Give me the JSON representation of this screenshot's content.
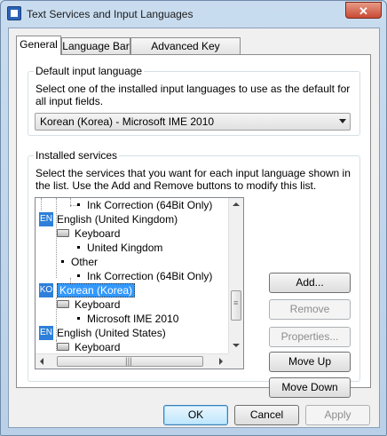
{
  "window": {
    "title": "Text Services and Input Languages",
    "close_label": "✕"
  },
  "tabs": [
    {
      "label": "General",
      "active": true
    },
    {
      "label": "Language Bar",
      "active": false
    },
    {
      "label": "Advanced Key Settings",
      "active": false
    }
  ],
  "default_language": {
    "group_label": "Default input language",
    "description": "Select one of the installed input languages to use as the default for all input fields.",
    "selected": "Korean (Korea) - Microsoft IME 2010"
  },
  "installed_services": {
    "group_label": "Installed services",
    "description": "Select the services that you want for each input language shown in the list. Use the Add and Remove buttons to modify this list.",
    "tree": {
      "r0": "Ink Correction (64Bit Only)",
      "r1_badge": "EN",
      "r1": "English (United Kingdom)",
      "r2": "Keyboard",
      "r3": "United Kingdom",
      "r4": "Other",
      "r5": "Ink Correction (64Bit Only)",
      "r6_badge": "KO",
      "r6": "Korean (Korea)",
      "r7": "Keyboard",
      "r8": "Microsoft IME 2010",
      "r9_badge": "EN",
      "r9": "English (United States)",
      "r10": "Keyboard"
    },
    "buttons": {
      "add": "Add...",
      "remove": "Remove",
      "properties": "Properties...",
      "move_up": "Move Up",
      "move_down": "Move Down"
    }
  },
  "footer": {
    "ok": "OK",
    "cancel": "Cancel",
    "apply": "Apply"
  },
  "colors": {
    "selection": "#3399ff",
    "lang_badge": "#2e7fd9",
    "default_button_border": "#3c7fb1"
  }
}
